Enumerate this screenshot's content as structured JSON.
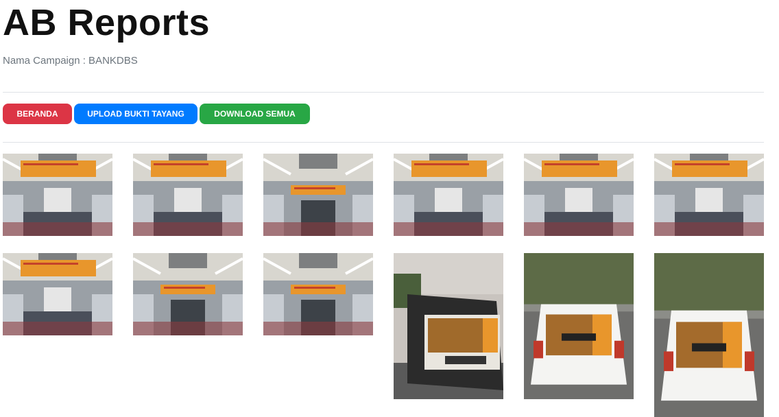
{
  "page": {
    "title": "AB Reports",
    "campaign_label": "Nama Campaign : BANKDBS"
  },
  "buttons": {
    "beranda": "BERANDA",
    "upload": "UPLOAD BUKTI TAYANG",
    "download": "DOWNLOAD SEMUA"
  },
  "colors": {
    "beranda": "#dc3545",
    "upload": "#007bff",
    "download": "#28a745",
    "banner": "#e8962c"
  },
  "photos": [
    {
      "kind": "train"
    },
    {
      "kind": "train"
    },
    {
      "kind": "train-door"
    },
    {
      "kind": "train"
    },
    {
      "kind": "train"
    },
    {
      "kind": "train"
    },
    {
      "kind": "train"
    },
    {
      "kind": "train-door"
    },
    {
      "kind": "train-door"
    },
    {
      "kind": "car-side"
    },
    {
      "kind": "car-rear"
    },
    {
      "kind": "car-rear"
    }
  ]
}
